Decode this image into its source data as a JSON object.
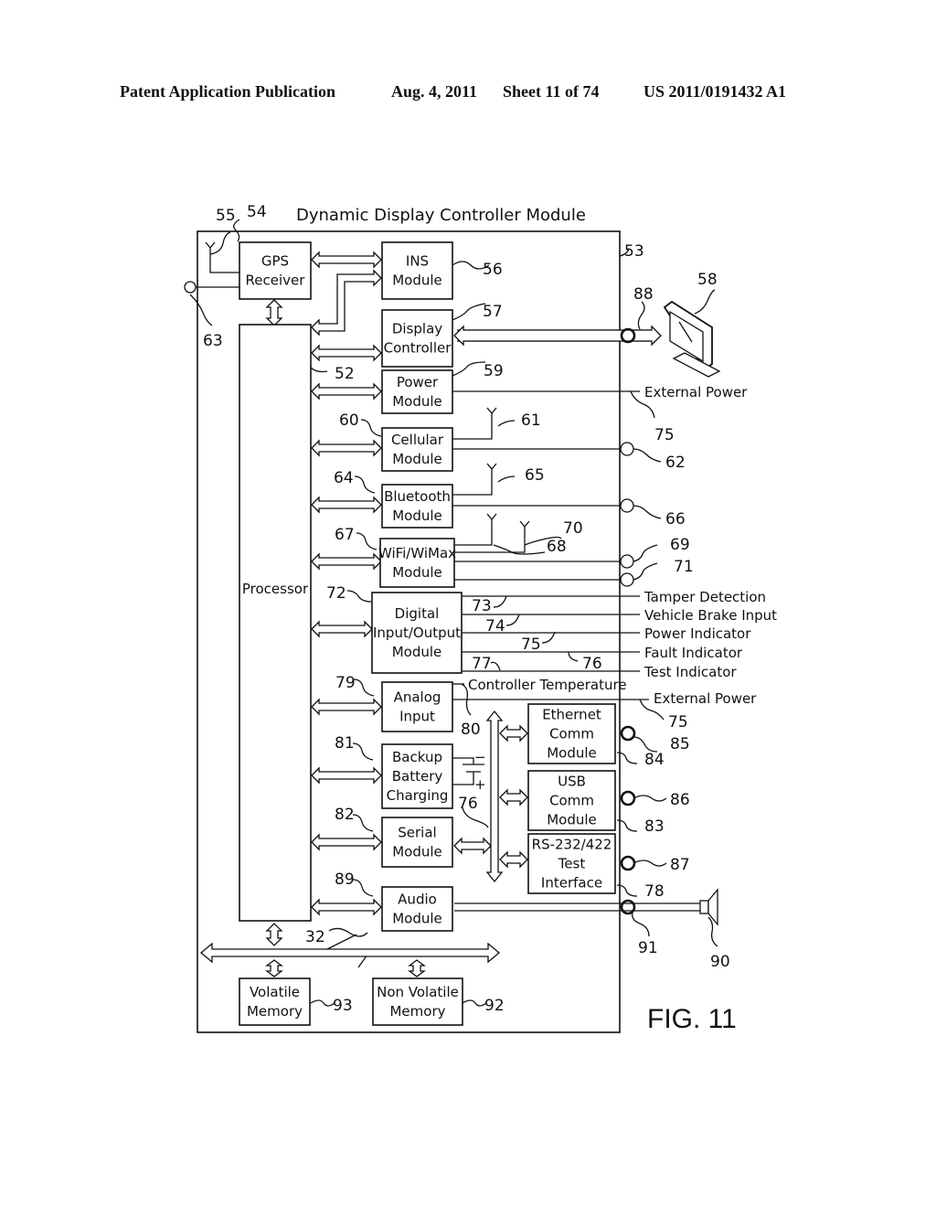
{
  "header": {
    "publication": "Patent Application Publication",
    "date": "Aug. 4, 2011",
    "sheet": "Sheet 11 of 74",
    "number": "US 2011/0191432 A1"
  },
  "diagram": {
    "title": "Dynamic Display Controller Module",
    "figure_label": "FIG. 11",
    "blocks": {
      "gps": [
        "GPS",
        "Receiver"
      ],
      "ins": [
        "INS",
        "Module"
      ],
      "display": [
        "Display",
        "Controller"
      ],
      "power": [
        "Power",
        "Module"
      ],
      "cellular": [
        "Cellular",
        "Module"
      ],
      "bluetooth": [
        "Bluetooth",
        "Module"
      ],
      "wifi": [
        "WiFi/WiMax",
        "Module"
      ],
      "processor": [
        "Processor"
      ],
      "dio": [
        "Digital",
        "Input/Output",
        "Module"
      ],
      "analog": [
        "Analog",
        "Input"
      ],
      "battery": [
        "Backup",
        "Battery",
        "Charging"
      ],
      "serial": [
        "Serial",
        "Module"
      ],
      "audio": [
        "Audio",
        "Module"
      ],
      "ethernet": [
        "Ethernet",
        "Comm",
        "Module"
      ],
      "usb": [
        "USB",
        "Comm",
        "Module"
      ],
      "rs232": [
        "RS-232/422",
        "Test",
        "Interface"
      ],
      "volatile": [
        "Volatile",
        "Memory"
      ],
      "nonvolatile": [
        "Non Volatile",
        "Memory"
      ]
    },
    "signals": {
      "external_power_1": "External Power",
      "tamper": "Tamper Detection",
      "brake": "Vehicle Brake Input",
      "power_ind": "Power Indicator",
      "fault": "Fault Indicator",
      "test": "Test Indicator",
      "controller_temp": "Controller Temperature",
      "external_power_2": "External Power"
    },
    "refs": {
      "r55": "55",
      "r54": "54",
      "r53": "53",
      "r63": "63",
      "r56": "56",
      "r57": "57",
      "r88": "88",
      "r58": "58",
      "r52": "52",
      "r59": "59",
      "r75a": "75",
      "r60": "60",
      "r61": "61",
      "r62": "62",
      "r64": "64",
      "r65": "65",
      "r66": "66",
      "r67": "67",
      "r70": "70",
      "r68": "68",
      "r69": "69",
      "r71": "71",
      "r72": "72",
      "r73": "73",
      "r74": "74",
      "r75b": "75",
      "r76a": "76",
      "r77": "77",
      "r79": "79",
      "r80": "80",
      "r75c": "75",
      "r85": "85",
      "r84": "84",
      "r81": "81",
      "r86": "86",
      "r76b": "76",
      "r83": "83",
      "r82": "82",
      "r87": "87",
      "r78": "78",
      "r89": "89",
      "r91": "91",
      "r90": "90",
      "r32": "32",
      "r93": "93",
      "r92": "92"
    },
    "battery_minus": "−",
    "battery_plus": "+"
  }
}
